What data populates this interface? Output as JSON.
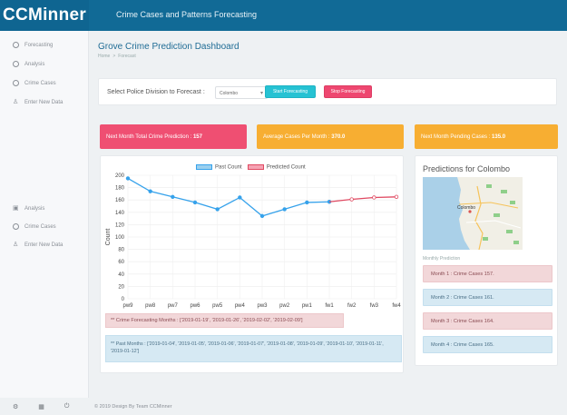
{
  "header": {
    "logo_text": "CCMinner",
    "app_title": "Crime Cases and Patterns Forecasting"
  },
  "sidebar": {
    "items_top": [
      {
        "label": "Forecasting",
        "icon": "clock-icon"
      },
      {
        "label": "Analysis",
        "icon": "clock-icon"
      },
      {
        "label": "Crime Cases",
        "icon": "clock-icon"
      },
      {
        "label": "Enter New Data",
        "icon": "user-add-icon"
      }
    ],
    "items_bottom": [
      {
        "label": "Analysis",
        "icon": "clipboard-icon"
      },
      {
        "label": "Crime Cases",
        "icon": "clock-icon"
      },
      {
        "label": "Enter New Data",
        "icon": "user-add-icon"
      }
    ]
  },
  "page": {
    "title": "Grove Crime Prediction Dashboard",
    "breadcrumb_home": "Home",
    "breadcrumb_sep": ">",
    "breadcrumb_current": "Forecast"
  },
  "selector": {
    "label": "Select Police Division to Forecast :",
    "selected": "Colombo",
    "start_label": "Start Forecasting",
    "stop_label": "Stop Forecasting"
  },
  "stats": {
    "total_label": "Next Month Total Crime Prediction :",
    "total_value": "157",
    "avg_label": "Average Cases Per Month :",
    "avg_value": "370.0",
    "pending_label": "Next Month Pending Cases :",
    "pending_value": "135.0"
  },
  "chart_data": {
    "type": "line",
    "categories": [
      "pw9",
      "pw8",
      "pw7",
      "pw6",
      "pw5",
      "pw4",
      "pw3",
      "pw2",
      "pw1",
      "fw1",
      "fw2",
      "fw3",
      "fw4"
    ],
    "series": [
      {
        "name": "Past Count",
        "color": "#36a2eb",
        "x": [
          "pw9",
          "pw8",
          "pw7",
          "pw6",
          "pw5",
          "pw4",
          "pw3",
          "pw2",
          "pw1",
          "fw1"
        ],
        "values": [
          195,
          174,
          165,
          156,
          145,
          164,
          134,
          145,
          156,
          157
        ]
      },
      {
        "name": "Predicted Count",
        "color": "#e04a62",
        "x": [
          "fw1",
          "fw2",
          "fw3",
          "fw4"
        ],
        "values": [
          157,
          161,
          164,
          165
        ]
      }
    ],
    "ylabel": "Count",
    "xlabel": "",
    "ylim": [
      0,
      200
    ],
    "yticks": [
      0,
      20,
      40,
      60,
      80,
      100,
      120,
      140,
      160,
      180,
      200
    ],
    "grid": true,
    "legend": "top-center"
  },
  "notes": {
    "forecast_months": "** Crime Forecasting Months : ['2019-01-19', '2019-01-26', '2019-02-02', '2019-02-09']",
    "past_months": "** Past Months : ['2019-01-04', '2019-01-05', '2019-01-06', '2019-01-07', '2019-01-08', '2019-01-09', '2019-01-10', '2019-01-11', '2019-01-12']"
  },
  "predictions": {
    "title": "Predictions for Colombo",
    "map_label": "Colombo",
    "monthly_label": "Monthly Prediction",
    "months": [
      {
        "label": "Month 1 : Crime Cases 157.",
        "style": "pink"
      },
      {
        "label": "Month 2 : Crime Cases 161.",
        "style": "blue"
      },
      {
        "label": "Month 3 : Crime Cases 164.",
        "style": "pink"
      },
      {
        "label": "Month 4 : Crime Cases 165.",
        "style": "blue"
      }
    ]
  },
  "footer": {
    "text": "© 2019 Design By Team CCMinner",
    "icons": [
      "settings-icon",
      "grid-icon",
      "power-icon"
    ]
  }
}
